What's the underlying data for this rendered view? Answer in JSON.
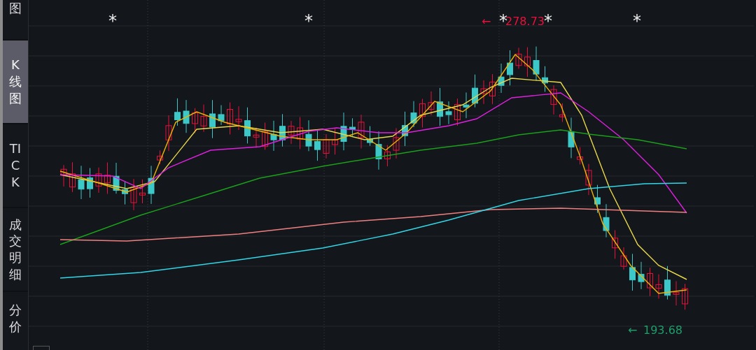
{
  "sidebar": {
    "tabs": [
      {
        "label": "图",
        "selected": false
      },
      {
        "label": "K线图",
        "selected": true
      },
      {
        "label": "TICK",
        "selected": false
      },
      {
        "label": "成交明细",
        "selected": false
      },
      {
        "label": "分价",
        "selected": false
      }
    ]
  },
  "chart": {
    "markers": [
      "*",
      "*",
      "*",
      "*",
      "*"
    ],
    "price_labels": [
      {
        "kind": "high",
        "arrow": "←",
        "value": "278.73"
      },
      {
        "kind": "low",
        "arrow": "←",
        "value": "193.68"
      }
    ]
  }
}
